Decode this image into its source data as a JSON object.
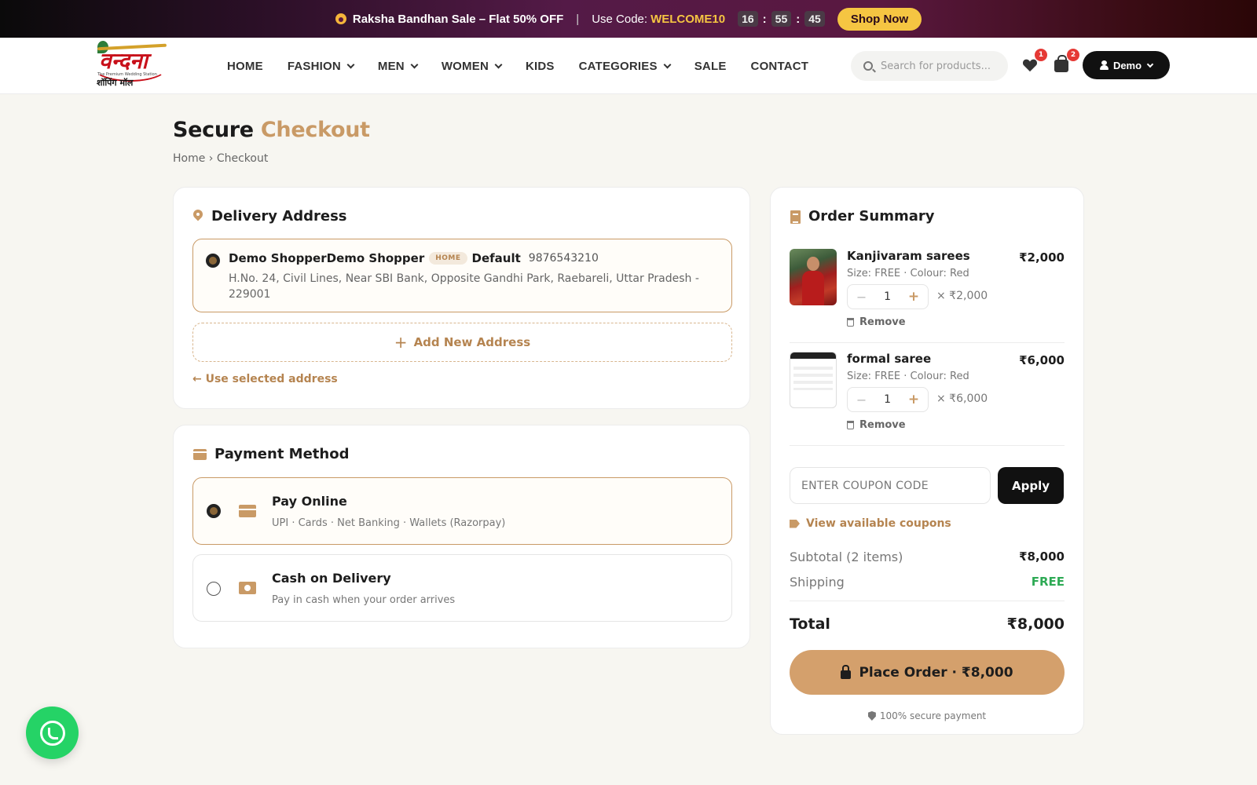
{
  "promo": {
    "message": "Raksha Bandhan Sale – Flat 50% OFF",
    "separator": "|",
    "code_label": "Use Code:",
    "code": "WELCOME10",
    "timer": [
      "16",
      "55",
      "45"
    ],
    "shop_label": "Shop Now"
  },
  "logo": {
    "brand": "वन्दना",
    "tagline": "शॉपिंग मॉल",
    "tiny": "The Premium Wedding Station"
  },
  "nav": {
    "items": [
      {
        "label": "HOME",
        "dropdown": false
      },
      {
        "label": "FASHION",
        "dropdown": true
      },
      {
        "label": "MEN",
        "dropdown": true
      },
      {
        "label": "WOMEN",
        "dropdown": true
      },
      {
        "label": "KIDS",
        "dropdown": false
      },
      {
        "label": "CATEGORIES",
        "dropdown": true
      },
      {
        "label": "SALE",
        "dropdown": false
      },
      {
        "label": "CONTACT",
        "dropdown": false
      }
    ],
    "search_placeholder": "Search for products...",
    "wishlist_count": "1",
    "cart_count": "2",
    "account_label": "Demo"
  },
  "page": {
    "title_main": "Secure",
    "title_accent": "Checkout",
    "breadcrumb": "Home › Checkout"
  },
  "delivery": {
    "title": "Delivery Address",
    "address": {
      "name": "Demo ShopperDemo Shopper",
      "tag": "HOME",
      "default_label": "Default",
      "phone": "9876543210",
      "line": "H.No. 24, Civil Lines, Near SBI Bank, Opposite Gandhi Park, Raebareli, Uttar Pradesh - 229001"
    },
    "add_new_label": "Add New Address",
    "use_selected_label": "← Use selected address"
  },
  "payment": {
    "title": "Payment Method",
    "options": [
      {
        "title": "Pay Online",
        "sub": "UPI · Cards · Net Banking · Wallets (Razorpay)",
        "selected": true
      },
      {
        "title": "Cash on Delivery",
        "sub": "Pay in cash when your order arrives",
        "selected": false
      }
    ]
  },
  "summary": {
    "title": "Order Summary",
    "items": [
      {
        "name": "Kanjivaram sarees",
        "price": "₹2,000",
        "meta": "Size: FREE · Colour: Red",
        "qty": "1",
        "unit": "× ₹2,000",
        "remove": "Remove"
      },
      {
        "name": "formal saree",
        "price": "₹6,000",
        "meta": "Size: FREE · Colour: Red",
        "qty": "1",
        "unit": "× ₹6,000",
        "remove": "Remove"
      }
    ],
    "coupon_placeholder": "ENTER COUPON CODE",
    "apply_label": "Apply",
    "view_coupons_label": "View available coupons",
    "subtotal_label": "Subtotal (2 items)",
    "subtotal_value": "₹8,000",
    "shipping_label": "Shipping",
    "shipping_value": "FREE",
    "total_label": "Total",
    "total_value": "₹8,000",
    "place_order_label": "Place Order · ₹8,000",
    "secure_label": "100% secure payment"
  },
  "colors": {
    "accent": "#c99a66",
    "promo_code": "#f5c542",
    "free": "#2eaa55",
    "whatsapp": "#25d366"
  }
}
